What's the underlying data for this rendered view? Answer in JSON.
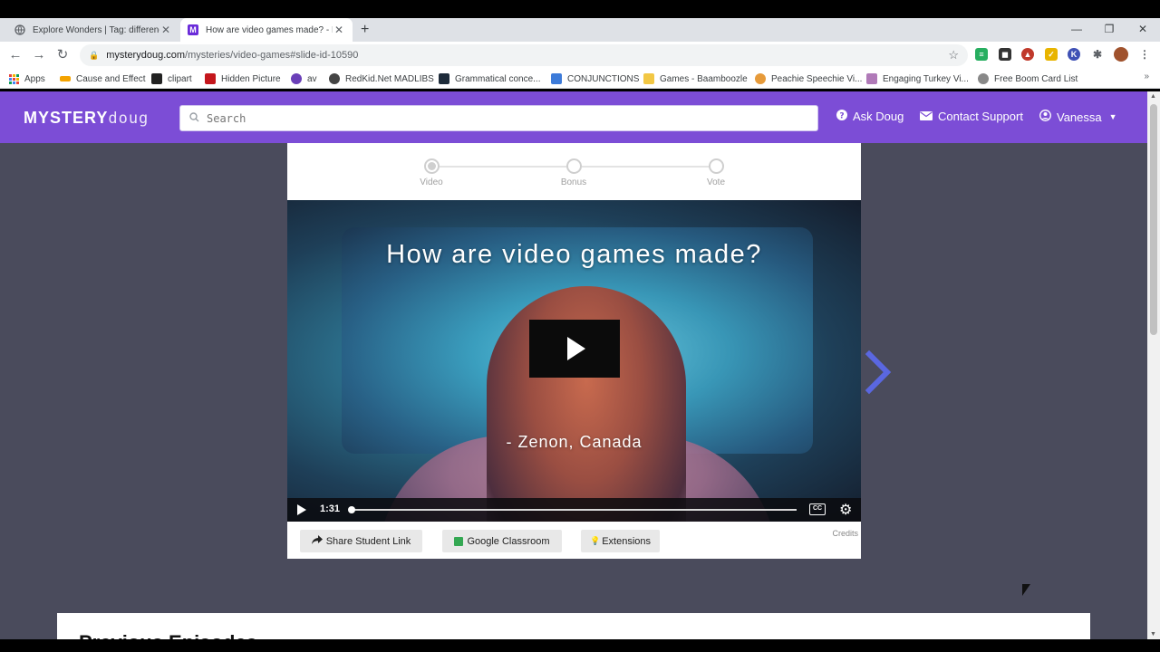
{
  "browser": {
    "tabs": [
      {
        "title": "Explore Wonders | Tag: difference",
        "favicon": "globe-icon",
        "active": false
      },
      {
        "title": "How are video games made? - M",
        "favicon": "M",
        "active": true
      }
    ],
    "new_tab": "+",
    "url_domain": "mysterydoug.com",
    "url_path": "/mysteries/video-games#slide-id-10590",
    "bookmarks": [
      {
        "label": "Apps",
        "color": "#e8453c"
      },
      {
        "label": "Cause and Effect",
        "color": "#f4a300"
      },
      {
        "label": "clipart",
        "color": "#222222"
      },
      {
        "label": "Hidden Picture",
        "color": "#c4161c"
      },
      {
        "label": "av",
        "color": "#6a3fb8"
      },
      {
        "label": "RedKid.Net MADLIBS",
        "color": "#444444"
      },
      {
        "label": "Grammatical conce...",
        "color": "#1d2b3a"
      },
      {
        "label": "CONJUNCTIONS",
        "color": "#3d7bd9"
      },
      {
        "label": "Games - Baamboozle",
        "color": "#f2c744"
      },
      {
        "label": "Peachie Speechie Vi...",
        "color": "#e69a3a"
      },
      {
        "label": "Engaging Turkey Vi...",
        "color": "#b07ab8"
      },
      {
        "label": "Free Boom Card List",
        "color": "#888888"
      }
    ]
  },
  "site": {
    "logo_bold": "MYSTERY",
    "logo_light": "doug",
    "search_placeholder": "Search",
    "nav": {
      "ask": "Ask Doug",
      "support": "Contact Support",
      "user": "Vanessa"
    },
    "brand_color": "#7c4dd6"
  },
  "lesson": {
    "steps": [
      "Video",
      "Bonus",
      "Vote"
    ],
    "video_title": "How are video games made?",
    "video_credit": "- Zenon, Canada",
    "duration": "1:31",
    "cc_label": "CC",
    "actions": {
      "share": "Share Student Link",
      "classroom": "Google Classroom",
      "extensions": "Extensions"
    },
    "credits": "Credits"
  },
  "previous": {
    "heading": "Previous Episodes"
  }
}
